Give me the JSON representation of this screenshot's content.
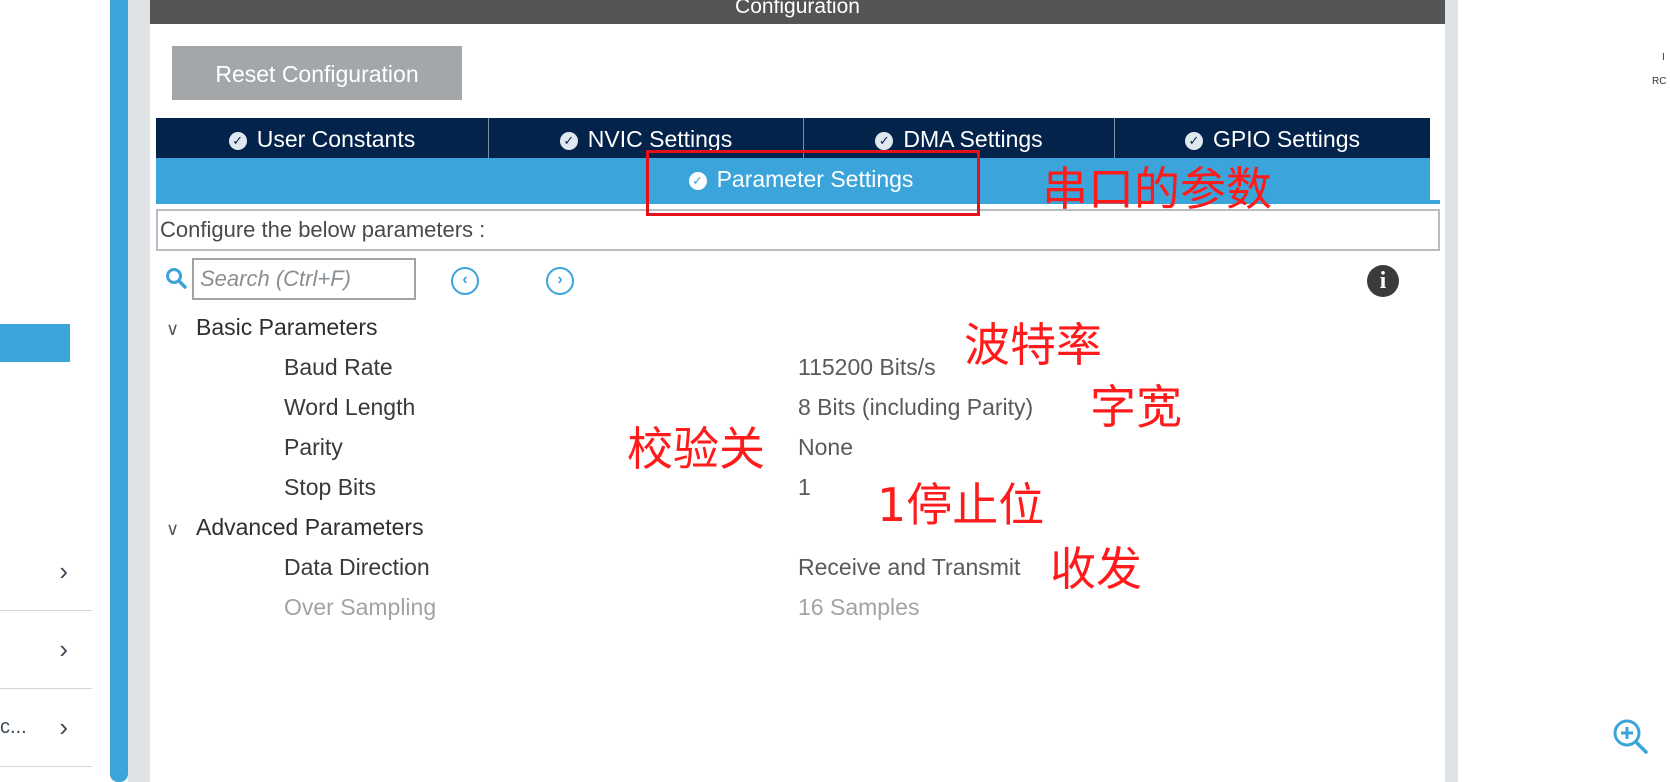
{
  "left_panel": {
    "rows": [
      {
        "label": ""
      },
      {
        "label": ""
      },
      {
        "label": "c..."
      }
    ]
  },
  "window": {
    "title": "Configuration",
    "reset_button": "Reset Configuration"
  },
  "tabs": [
    {
      "label": "User Constants"
    },
    {
      "label": "NVIC Settings"
    },
    {
      "label": "DMA Settings"
    },
    {
      "label": "GPIO Settings"
    }
  ],
  "active_tab": {
    "label": "Parameter Settings"
  },
  "configure_label": "Configure the below parameters :",
  "search": {
    "placeholder": "Search (Ctrl+F)"
  },
  "groups": [
    {
      "title": "Basic Parameters",
      "params": [
        {
          "name": "Baud Rate",
          "value": "115200 Bits/s"
        },
        {
          "name": "Word Length",
          "value": "8 Bits (including Parity)"
        },
        {
          "name": "Parity",
          "value": "None"
        },
        {
          "name": "Stop Bits",
          "value": "1"
        }
      ]
    },
    {
      "title": "Advanced Parameters",
      "params": [
        {
          "name": "Data Direction",
          "value": "Receive and Transmit"
        },
        {
          "name": "Over Sampling",
          "value": "16 Samples",
          "disabled": true
        }
      ]
    }
  ],
  "annotations": {
    "serial_params": "串口的参数",
    "baud_rate": "波特率",
    "word_width": "字宽",
    "parity_off": "校验关",
    "stop_bit": "1停止位",
    "rx_tx": "收发"
  },
  "right_panel": {
    "text1": "I",
    "text2": "RC"
  },
  "colors": {
    "accent": "#3aa4db",
    "tab_bar": "#03234b",
    "title_bar": "#545454",
    "annotation_red": "#ff1b1b"
  },
  "icons": [
    "check-circle-icon",
    "search-icon",
    "chevron-left-circle-icon",
    "chevron-right-circle-icon",
    "info-icon",
    "zoom-in-icon",
    "chevron-right-icon",
    "chevron-down-icon"
  ]
}
